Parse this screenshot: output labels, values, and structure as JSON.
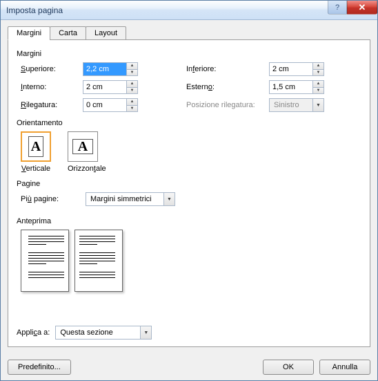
{
  "window": {
    "title": "Imposta pagina"
  },
  "tabs": {
    "t0": "Margini",
    "t1": "Carta",
    "t2": "Layout"
  },
  "groups": {
    "margini": "Margini",
    "orientamento": "Orientamento",
    "pagine": "Pagine",
    "anteprima": "Anteprima"
  },
  "margins": {
    "superiore_label": "Superiore:",
    "superiore_value": "2,2 cm",
    "inferiore_label": "Inferiore:",
    "inferiore_value": "2 cm",
    "interno_label": "Interno:",
    "interno_value": "2 cm",
    "esterno_label": "Esterno:",
    "esterno_value": "1,5 cm",
    "rilegatura_label": "Rilegatura:",
    "rilegatura_value": "0 cm",
    "posizione_label": "Posizione rilegatura:",
    "posizione_value": "Sinistro"
  },
  "orientation": {
    "verticale": "Verticale",
    "orizzontale": "Orizzontale",
    "glyph": "A"
  },
  "pages": {
    "label": "Più pagine:",
    "value": "Margini simmetrici"
  },
  "apply": {
    "label": "Applica a:",
    "value": "Questa sezione"
  },
  "buttons": {
    "predefinito": "Predefinito...",
    "ok": "OK",
    "annulla": "Annulla"
  },
  "titlebar": {
    "help": "?",
    "close": "✕"
  },
  "arrows": {
    "up": "▲",
    "down": "▼"
  }
}
